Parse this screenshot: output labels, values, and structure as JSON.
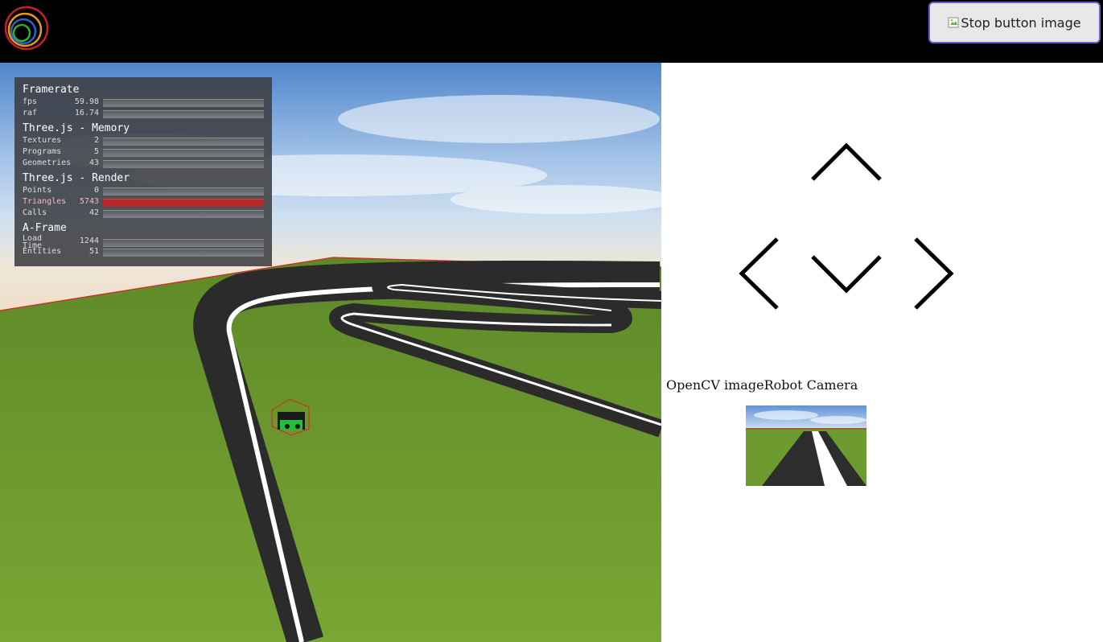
{
  "stop_button": {
    "alt": "Stop button image"
  },
  "stats": {
    "framerate": {
      "title": "Framerate",
      "rows": [
        {
          "label": "fps",
          "value": "59.98"
        },
        {
          "label": "raf",
          "value": "16.74"
        }
      ]
    },
    "memory": {
      "title": "Three.js - Memory",
      "rows": [
        {
          "label": "Textures",
          "value": "2"
        },
        {
          "label": "Programs",
          "value": "5"
        },
        {
          "label": "Geometries",
          "value": "43"
        }
      ]
    },
    "render": {
      "title": "Three.js - Render",
      "rows": [
        {
          "label": "Points",
          "value": "0"
        },
        {
          "label": "Triangles",
          "value": "5743"
        },
        {
          "label": "Calls",
          "value": "42"
        }
      ]
    },
    "aframe": {
      "title": "A-Frame",
      "rows": [
        {
          "label": "Load\nTime",
          "value": "1244"
        },
        {
          "label": "Entities",
          "value": "51"
        }
      ]
    }
  },
  "controls": {
    "up": "chevron-up-icon",
    "down": "chevron-down-icon",
    "left": "chevron-left-icon",
    "right": "chevron-right-icon"
  },
  "camera": {
    "opencv_label": "OpenCV image",
    "robot_label": "Robot Camera"
  },
  "colors": {
    "grass": "#6f9a2e",
    "track": "#2a2a2a",
    "line": "#ffffff",
    "warn_bar": "#b82a2a"
  }
}
